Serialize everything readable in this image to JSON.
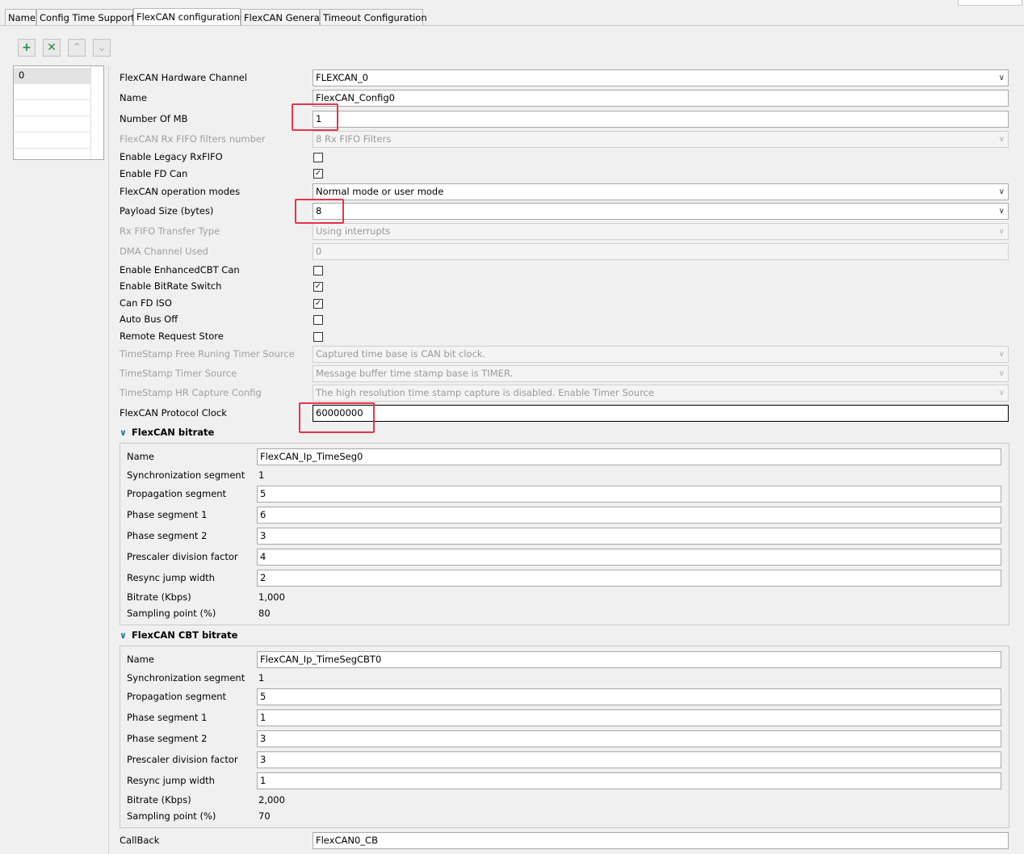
{
  "tabs": [
    "Name",
    "Config Time Support",
    "FlexCAN configurations",
    "FlexCAN General",
    "Timeout Configuration"
  ],
  "toolbar": {
    "add": "+",
    "remove": "✕",
    "up": "^",
    "down": "v"
  },
  "list": {
    "selected": "0"
  },
  "config": {
    "hw_channel": {
      "label": "FlexCAN Hardware Channel",
      "value": "FLEXCAN_0"
    },
    "name": {
      "label": "Name",
      "value": "FlexCAN_Config0"
    },
    "num_mb": {
      "label": "Number Of MB",
      "value": "1"
    },
    "rx_fifo_filters": {
      "label": "FlexCAN Rx FIFO filters number",
      "value": "8 Rx FIFO Filters"
    },
    "legacy_rxfifo": {
      "label": "Enable Legacy RxFIFO",
      "checked": false
    },
    "fd_can": {
      "label": "Enable FD Can",
      "checked": true
    },
    "op_modes": {
      "label": "FlexCAN operation modes",
      "value": "Normal mode or user mode"
    },
    "payload": {
      "label": "Payload Size (bytes)",
      "value": "8"
    },
    "rx_fifo_transfer": {
      "label": "Rx FIFO Transfer Type",
      "value": "Using interrupts"
    },
    "dma_channel": {
      "label": "DMA Channel Used",
      "value": "0"
    },
    "enhanced_cbt": {
      "label": "Enable EnhancedCBT Can",
      "checked": false
    },
    "bitrate_switch": {
      "label": "Enable BitRate Switch",
      "checked": true
    },
    "fd_iso": {
      "label": "Can FD ISO",
      "checked": true
    },
    "auto_bus_off": {
      "label": "Auto Bus Off",
      "checked": false
    },
    "remote_req": {
      "label": "Remote Request Store",
      "checked": false
    },
    "ts_free_timer": {
      "label": "TimeStamp Free Runing Timer Source",
      "value": "Captured time base is CAN bit clock."
    },
    "ts_timer": {
      "label": "TimeStamp Timer Source",
      "value": "Message buffer time stamp base is TIMER."
    },
    "ts_hr": {
      "label": "TimeStamp HR Capture Config",
      "value": "The high resolution time stamp capture is disabled. Enable Timer Source"
    },
    "proto_clock": {
      "label": "FlexCAN Protocol Clock",
      "value": "60000000"
    },
    "callback": {
      "label": "CallBack",
      "value": "FlexCAN0_CB"
    }
  },
  "bitrate": {
    "title": "FlexCAN bitrate",
    "labels": {
      "name": "Name",
      "sync": "Synchronization segment",
      "prop": "Propagation segment",
      "ph1": "Phase segment 1",
      "ph2": "Phase segment 2",
      "presc": "Prescaler division factor",
      "rjw": "Resync jump width",
      "bitrate": "Bitrate (Kbps)",
      "sample": "Sampling point (%)"
    },
    "values": {
      "name": "FlexCAN_Ip_TimeSeg0",
      "sync": "1",
      "prop": "5",
      "ph1": "6",
      "ph2": "3",
      "presc": "4",
      "rjw": "2",
      "bitrate": "1,000",
      "sample": "80"
    }
  },
  "cbt": {
    "title": "FlexCAN CBT bitrate",
    "labels": {
      "name": "Name",
      "sync": "Synchronization segment",
      "prop": "Propagation segment",
      "ph1": "Phase segment 1",
      "ph2": "Phase segment 2",
      "presc": "Prescaler division factor",
      "rjw": "Resync jump width",
      "bitrate": "Bitrate (Kbps)",
      "sample": "Sampling point (%)"
    },
    "values": {
      "name": "FlexCAN_Ip_TimeSegCBT0",
      "sync": "1",
      "prop": "5",
      "ph1": "1",
      "ph2": "3",
      "presc": "3",
      "rjw": "1",
      "bitrate": "2,000",
      "sample": "70"
    }
  },
  "icons": {
    "dropdown": "chevron-down-icon",
    "collapse": "chevron-down-icon",
    "check": "✓"
  },
  "colors": {
    "highlight": "#e8344a"
  }
}
